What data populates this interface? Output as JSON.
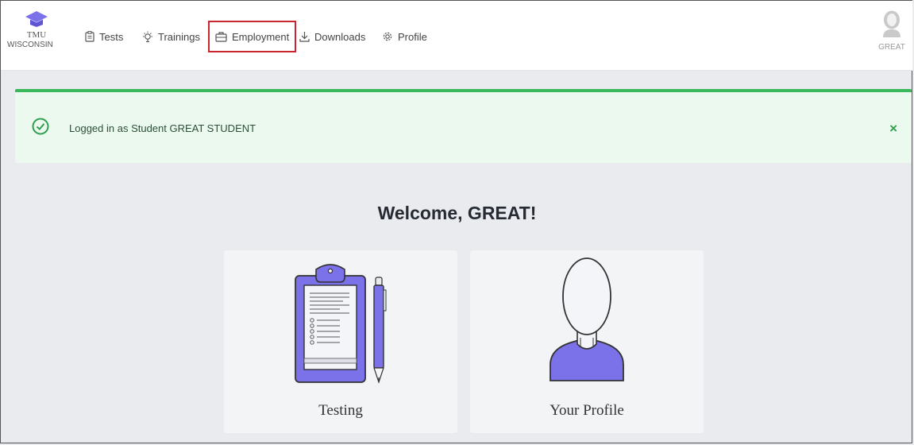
{
  "brand": {
    "school": "TMU",
    "state": "WISCONSIN"
  },
  "nav": {
    "items": [
      {
        "label": "Tests",
        "icon": "clipboard-icon"
      },
      {
        "label": "Trainings",
        "icon": "lightbulb-icon"
      },
      {
        "label": "Employment",
        "icon": "briefcase-icon",
        "highlighted": true
      },
      {
        "label": "Downloads",
        "icon": "download-icon"
      },
      {
        "label": "Profile",
        "icon": "gear-icon"
      }
    ]
  },
  "user": {
    "name": "GREAT"
  },
  "alert": {
    "message": "Logged in as Student GREAT STUDENT",
    "close_label": "×",
    "color": "#3bb85b"
  },
  "main": {
    "welcome": "Welcome, GREAT!",
    "cards": [
      {
        "label": "Testing",
        "icon": "clipboard-illustration"
      },
      {
        "label": "Your Profile",
        "icon": "person-illustration"
      }
    ]
  },
  "colors": {
    "accent": "#7b72e9",
    "highlight_border": "#c8252e",
    "success": "#3bb85b"
  }
}
